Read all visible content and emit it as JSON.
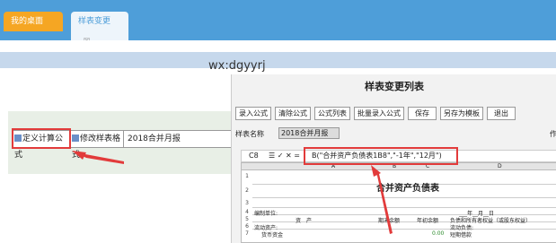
{
  "tabs": {
    "home": "我的桌面",
    "active": "样表变更",
    "close": "☒"
  },
  "watermark": "wx:dgyyrj",
  "left_toolbar": {
    "btn1": "定义计算公式",
    "btn2": "修改样表格式",
    "btn3": "2018合并月报"
  },
  "dialog": {
    "title": "样表变更列表",
    "buttons": [
      "录入公式",
      "清除公式",
      "公式列表",
      "批量录入公式",
      "保存",
      "另存为模板",
      "退出"
    ],
    "name_label": "样表名称",
    "name_value": "2018合并月报",
    "right_mark": "作"
  },
  "formula_bar": {
    "cell": "C8",
    "icons": "☰ ✓ ✕ =",
    "formula": "B(\"合并资产负债表1B8\",\"-1年\",\"12月\")"
  },
  "sheet": {
    "columns": [
      "A",
      "B",
      "C",
      "D"
    ],
    "title": "合并资产负债表",
    "rows": [
      "1",
      "2",
      "3",
      "4",
      "5",
      "6",
      "7"
    ],
    "row4_left": "编制单位:",
    "row4_right": "___年__月__日",
    "row5": [
      "资　产",
      "期末余额",
      "年初余额",
      "负债和所有者权益（或股东权益）"
    ],
    "row6_left": "流动资产:",
    "row6_right": "流动负债:",
    "row7_left": "货币资金",
    "row7_val": "0.00",
    "row7_right": "短期借款"
  }
}
